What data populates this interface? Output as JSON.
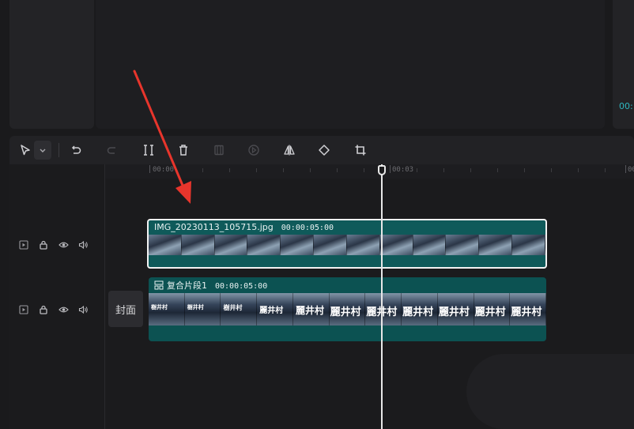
{
  "preview": {
    "right_time": "00:"
  },
  "toolbar": {
    "tools": [
      {
        "name": "select-tool-icon"
      },
      {
        "name": "select-dropdown-icon"
      },
      {
        "name": "undo-icon"
      },
      {
        "name": "redo-icon"
      },
      {
        "name": "split-icon"
      },
      {
        "name": "delete-icon"
      },
      {
        "name": "freeze-icon"
      },
      {
        "name": "reverse-icon"
      },
      {
        "name": "mirror-icon"
      },
      {
        "name": "rotate-icon"
      },
      {
        "name": "crop-icon"
      }
    ]
  },
  "ruler": {
    "labels": [
      "00:00",
      "00:03",
      "00:"
    ]
  },
  "tracks": [
    {
      "clip_name": "IMG_20230113_105715.jpg",
      "clip_duration": "00:00:05:00"
    },
    {
      "cover_label": "封面",
      "clip_name": "复合片段1",
      "clip_duration": "00:00:05:00",
      "overlay_text": [
        "樹井村",
        "樹井村",
        "樹井村",
        "麗井村",
        "麗井村",
        "麗井村",
        "麗井村",
        "麗井村",
        "麗井村",
        "麗井村",
        "麗井村"
      ]
    }
  ],
  "colors": {
    "accent": "#2fb7c0",
    "clip": "#0f5a5a",
    "arrow": "#e8352c"
  }
}
